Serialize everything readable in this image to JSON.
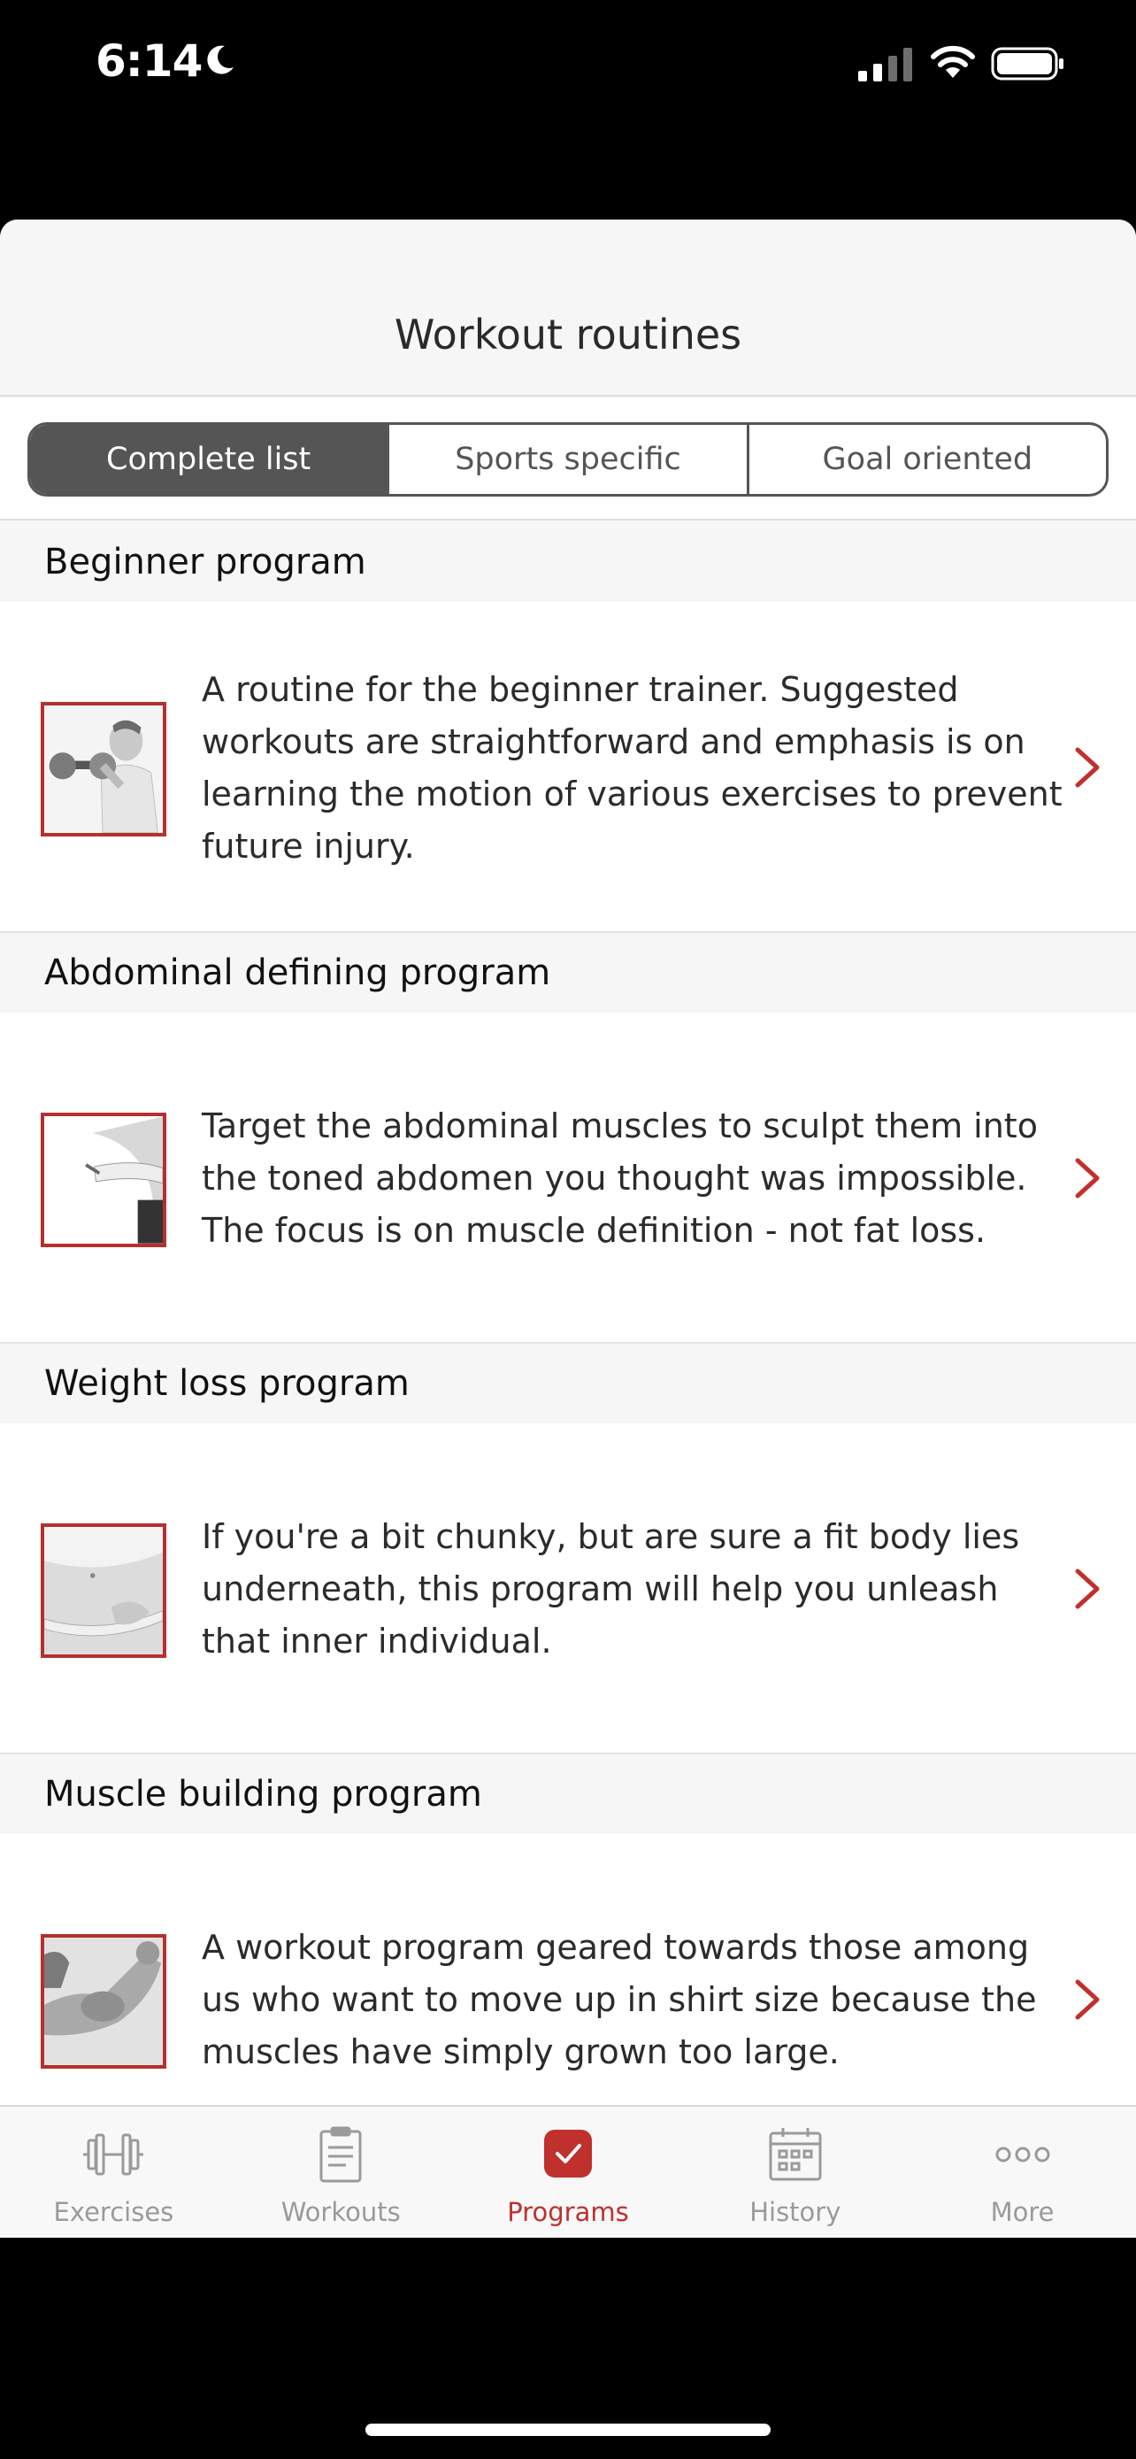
{
  "status_bar": {
    "time": "6:14"
  },
  "header": {
    "title": "Workout routines"
  },
  "segments": [
    {
      "label": "Complete list",
      "active": true
    },
    {
      "label": "Sports specific",
      "active": false
    },
    {
      "label": "Goal oriented",
      "active": false
    }
  ],
  "programs": [
    {
      "title": "Beginner program",
      "description": "A routine for the beginner trainer. Suggested workouts are straightforward and emphasis is on learning the motion of various exercises to prevent future injury.",
      "image": "boy-dumbbell-photo"
    },
    {
      "title": "Abdominal defining program",
      "description": "Target the abdominal muscles to sculpt them into the toned abdomen you thought was impossible. The focus is on muscle definition - not fat loss.",
      "image": "belly-measure-photo"
    },
    {
      "title": "Weight loss program",
      "description": "If you're a bit chunky, but are sure a fit body lies underneath, this program will help you unleash that inner individual.",
      "image": "waist-tape-photo"
    },
    {
      "title": "Muscle building program",
      "description": "A workout program geared towards those among us who want to move up in shirt size because the muscles have simply grown too large.",
      "image": "flexed-arm-photo"
    }
  ],
  "tabs": [
    {
      "label": "Exercises",
      "icon": "dumbbell-icon",
      "active": false
    },
    {
      "label": "Workouts",
      "icon": "clipboard-icon",
      "active": false
    },
    {
      "label": "Programs",
      "icon": "checkmark-icon",
      "active": true
    },
    {
      "label": "History",
      "icon": "calendar-icon",
      "active": false
    },
    {
      "label": "More",
      "icon": "more-dots-icon",
      "active": false
    }
  ],
  "colors": {
    "accent": "#c0302d",
    "segment_active": "#555555",
    "background": "#f6f6f6"
  }
}
